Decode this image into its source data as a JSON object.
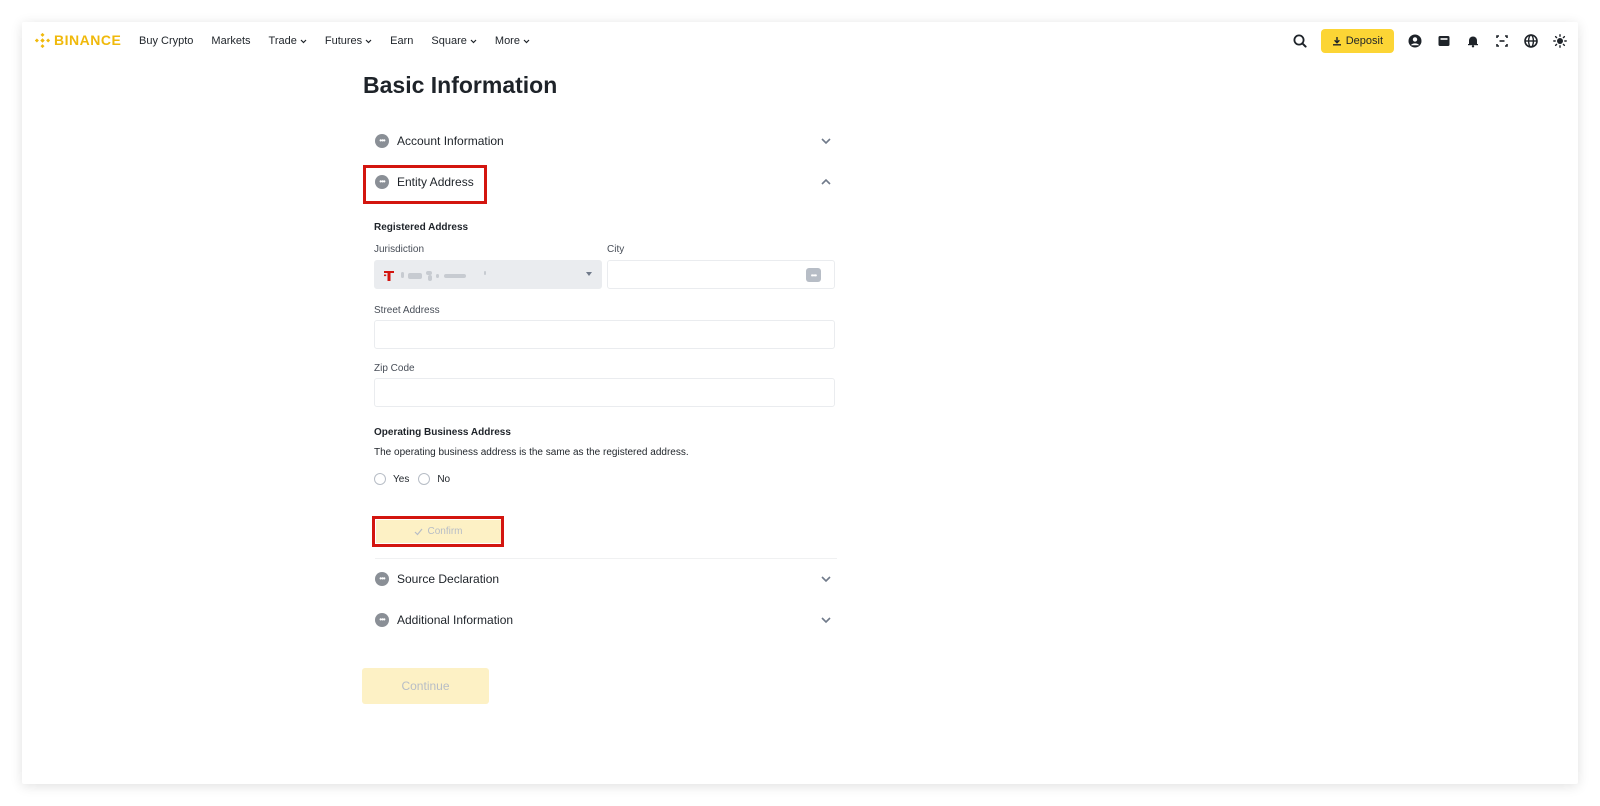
{
  "brand": {
    "name": "BINANCE",
    "color": "#f0b90b"
  },
  "nav": {
    "items": [
      {
        "label": "Buy Crypto",
        "dropdown": false
      },
      {
        "label": "Markets",
        "dropdown": false
      },
      {
        "label": "Trade",
        "dropdown": true
      },
      {
        "label": "Futures",
        "dropdown": true
      },
      {
        "label": "Earn",
        "dropdown": false
      },
      {
        "label": "Square",
        "dropdown": true
      },
      {
        "label": "More",
        "dropdown": true
      }
    ],
    "deposit_label": "Deposit",
    "icons": [
      "search-icon",
      "profile-icon",
      "wallet-icon",
      "notification-bell-icon",
      "download-app-icon",
      "language-globe-icon",
      "theme-toggle-icon"
    ]
  },
  "page": {
    "title": "Basic Information",
    "sections": {
      "account": {
        "label": "Account Information",
        "expanded": false
      },
      "entity": {
        "label": "Entity Address",
        "expanded": true
      },
      "source": {
        "label": "Source Declaration",
        "expanded": false
      },
      "additional": {
        "label": "Additional Information",
        "expanded": false
      }
    },
    "form": {
      "registered_heading": "Registered Address",
      "jurisdiction_label": "Jurisdiction",
      "jurisdiction_value": "",
      "city_label": "City",
      "city_value": "",
      "street_label": "Street Address",
      "street_value": "",
      "zip_label": "Zip Code",
      "zip_value": "",
      "operating_heading": "Operating Business Address",
      "operating_question": "The operating business address is the same as the registered address.",
      "yes_label": "Yes",
      "no_label": "No",
      "confirm_label": "Confirm"
    },
    "continue_label": "Continue"
  },
  "colors": {
    "accent": "#fcd535",
    "accent_disabled": "#fdf1c5",
    "highlight": "#d3150f"
  }
}
